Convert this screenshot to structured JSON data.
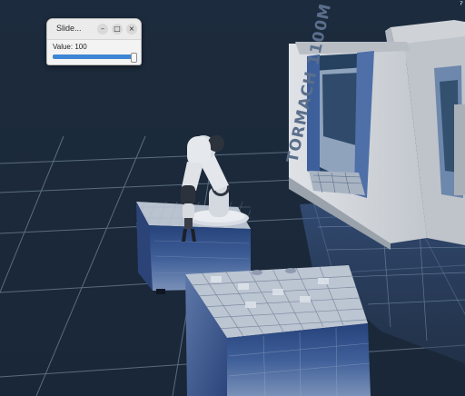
{
  "window": {
    "title": "Slide...",
    "minimize_icon": "minimize-icon",
    "maximize_icon": "maximize-icon",
    "close_icon": "close-icon"
  },
  "slider": {
    "label": "Value: 100",
    "value": 100,
    "min": 0,
    "max": 100
  },
  "scene": {
    "background_color": "#1b2a3c",
    "grid_color": "#8fa2b8",
    "machine_text": "TORMACH 1100M"
  },
  "colors": {
    "accent": "#3d86d6"
  }
}
